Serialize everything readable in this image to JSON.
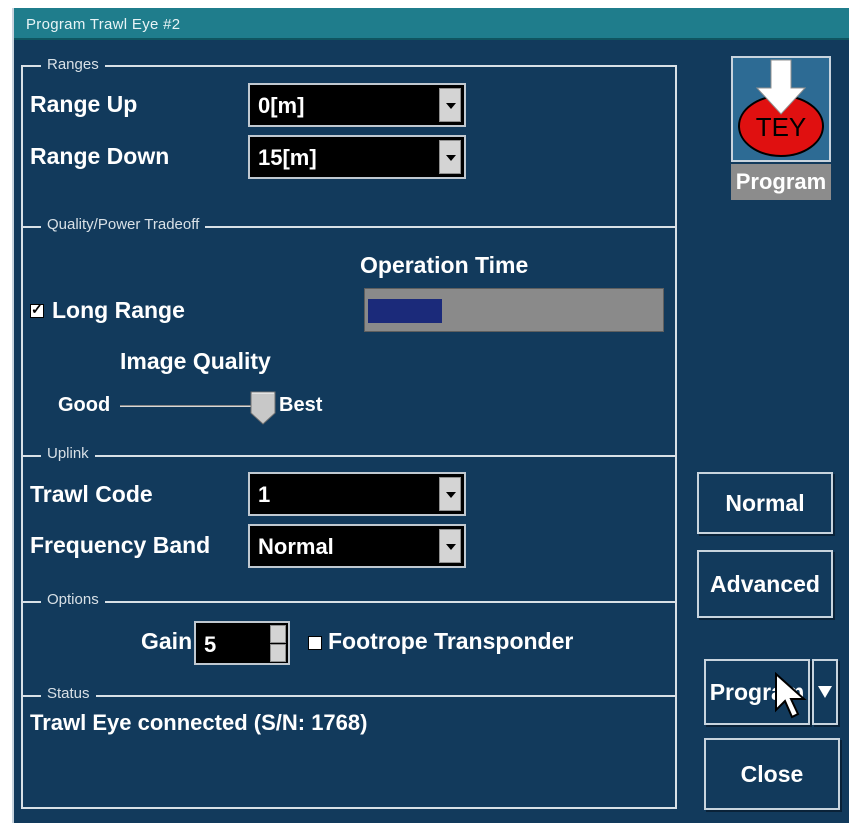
{
  "window": {
    "title": "Program Trawl Eye #2"
  },
  "ranges": {
    "section": "Ranges",
    "range_up": {
      "label": "Range Up",
      "value": "0[m]"
    },
    "range_down": {
      "label": "Range Down",
      "value": "15[m]"
    }
  },
  "tradeoff": {
    "section": "Quality/Power Tradeoff",
    "operation_time_label": "Operation Time",
    "operation_time_fraction": 0.25,
    "long_range": {
      "label": "Long Range",
      "checked": true
    },
    "image_quality_label": "Image Quality",
    "slider": {
      "min_label": "Good",
      "max_label": "Best",
      "position_fraction": 1.0
    }
  },
  "uplink": {
    "section": "Uplink",
    "trawl_code": {
      "label": "Trawl Code",
      "value": "1"
    },
    "frequency_band": {
      "label": "Frequency Band",
      "value": "Normal"
    }
  },
  "options": {
    "section": "Options",
    "gain": {
      "label": "Gain",
      "value": "5"
    },
    "footrope": {
      "label": "Footrope Transponder",
      "checked": false
    }
  },
  "status": {
    "section": "Status",
    "text": "Trawl Eye connected (S/N: 1768)"
  },
  "side": {
    "program_icon": {
      "badge_text": "TEY",
      "label": "Program"
    },
    "normal_button": "Normal",
    "advanced_button": "Advanced",
    "program_button": "Program",
    "close_button": "Close"
  },
  "colors": {
    "background": "#123a5c",
    "titlebar": "#1f7d8c",
    "progress_fill": "#1b2a7a",
    "icon_badge": "#e01010"
  }
}
